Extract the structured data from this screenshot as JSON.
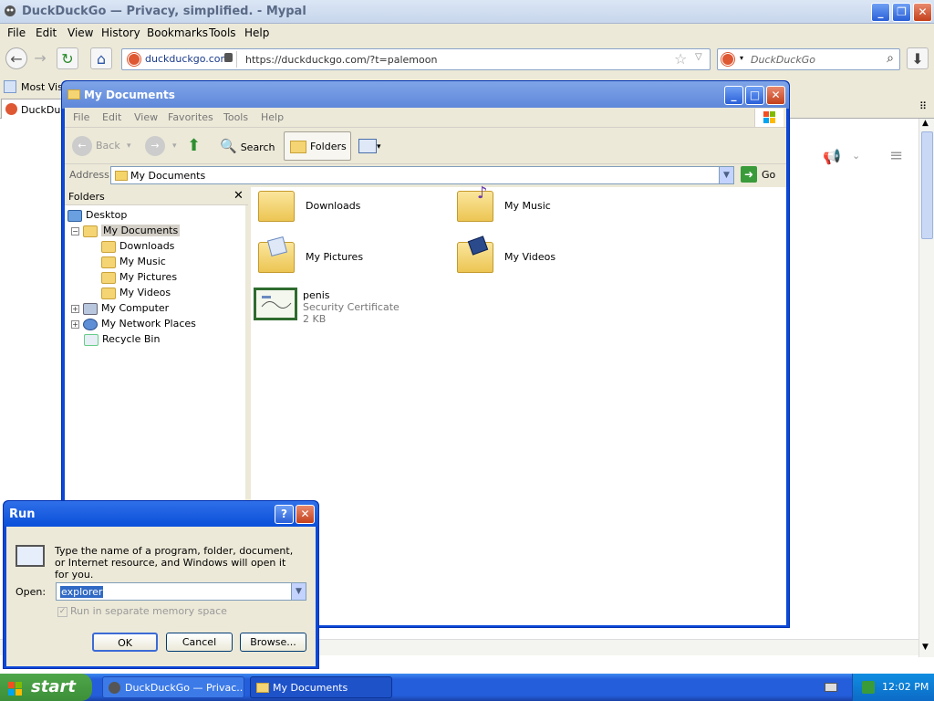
{
  "browser": {
    "title": "DuckDuckGo — Privacy, simplified. - Mypal",
    "menu": [
      "File",
      "Edit",
      "View",
      "History",
      "Bookmarks",
      "Tools",
      "Help"
    ],
    "site_identity": "duckduckgo.com",
    "url": "https://duckduckgo.com/?t=palemoon",
    "search_placeholder": "DuckDuckGo",
    "bookmark_item": "Most Visit",
    "tab_label": "DuckDuc"
  },
  "explorer": {
    "title": "My Documents",
    "menu": [
      "File",
      "Edit",
      "View",
      "Favorites",
      "Tools",
      "Help"
    ],
    "toolbar": {
      "back": "Back",
      "search": "Search",
      "folders": "Folders"
    },
    "address_label": "Address",
    "address_value": "My Documents",
    "go_label": "Go",
    "tree_header": "Folders",
    "tree": [
      "Desktop",
      "My Documents",
      "Downloads",
      "My Music",
      "My Pictures",
      "My Videos",
      "My Computer",
      "My Network Places",
      "Recycle Bin"
    ],
    "files": [
      {
        "name": "Downloads"
      },
      {
        "name": "My Music"
      },
      {
        "name": "My Pictures"
      },
      {
        "name": "My Videos"
      },
      {
        "name": "penis",
        "type": "Security Certificate",
        "size": "2 KB"
      }
    ]
  },
  "run": {
    "title": "Run",
    "description": "Type the name of a program, folder, document, or Internet resource, and Windows will open it for you.",
    "open_label": "Open:",
    "open_value": "explorer",
    "checkbox_label": "Run in separate memory space",
    "ok": "OK",
    "cancel": "Cancel",
    "browse": "Browse..."
  },
  "taskbar": {
    "start": "start",
    "tasks": [
      "DuckDuckGo — Privac...",
      "My Documents"
    ],
    "clock": "12:02 PM"
  }
}
